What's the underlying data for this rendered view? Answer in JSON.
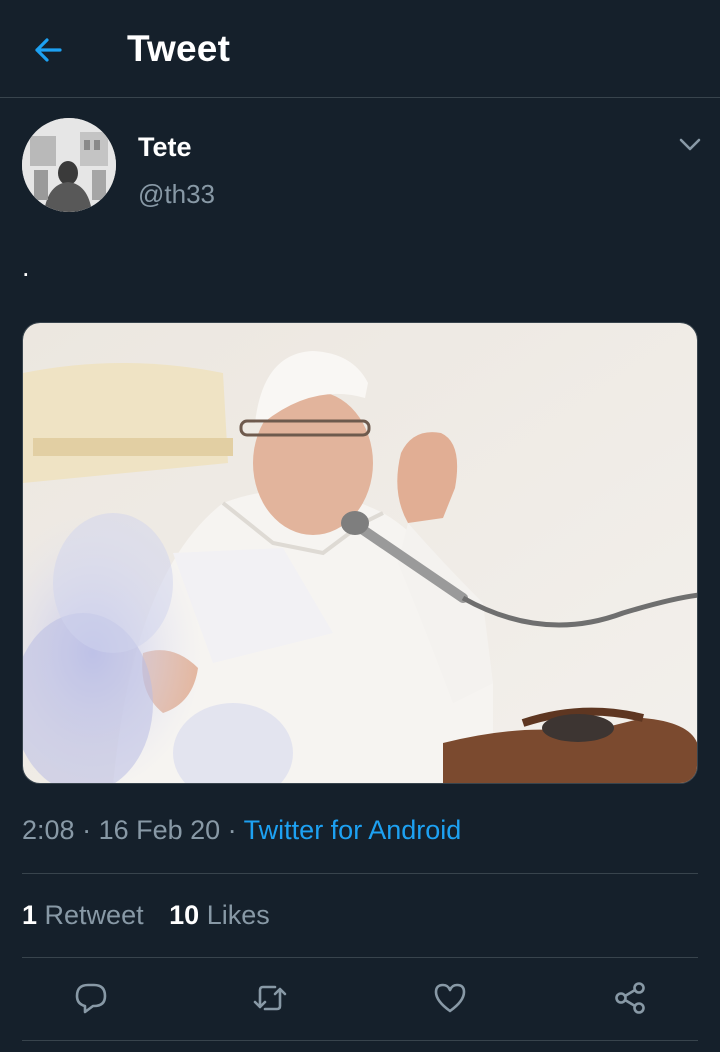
{
  "header": {
    "title": "Tweet",
    "back_icon": "arrow-left-icon"
  },
  "author": {
    "name": "Tete",
    "handle": "@th33",
    "avatar_icon": "avatar-photo"
  },
  "tweet": {
    "text": ".",
    "time": "2:08",
    "separator": " · ",
    "date": "16 Feb 20",
    "source": "Twitter for Android",
    "media_description": "photo"
  },
  "stats": {
    "retweets_count": "1",
    "retweets_label": "Retweet",
    "likes_count": "10",
    "likes_label": "Likes"
  },
  "actions": [
    "reply-icon",
    "retweet-icon",
    "like-icon",
    "share-icon"
  ],
  "colors": {
    "background": "#15202b",
    "accent": "#1da1f2",
    "muted": "#8899a6",
    "divider": "#38444d"
  }
}
